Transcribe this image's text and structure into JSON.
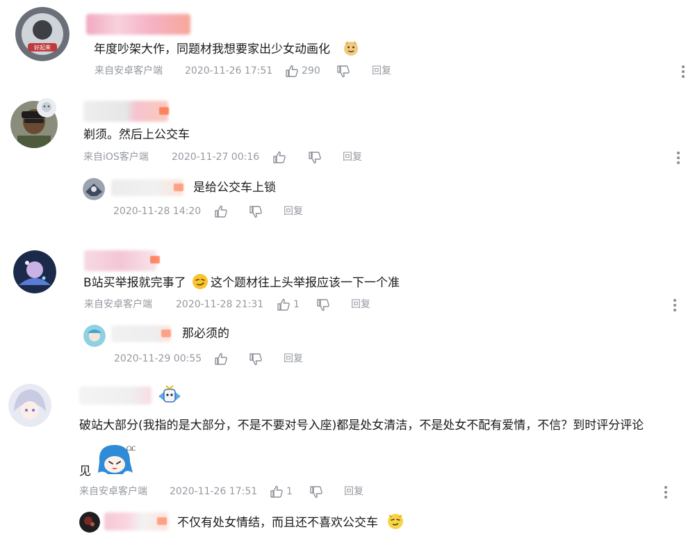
{
  "comments": [
    {
      "text": "年度吵架大作，同题材我想要家出少女动画化",
      "source": "来自安卓客户端",
      "time": "2020-11-26 17:51",
      "likes": "290",
      "reply": "回复"
    },
    {
      "text": "剃须。然后上公交车",
      "source": "来自iOS客户端",
      "time": "2020-11-27 00:16",
      "likes": "",
      "reply": "回复",
      "sub": {
        "text": "是给公交车上锁",
        "time": "2020-11-28 14:20",
        "reply": "回复"
      }
    },
    {
      "text": "B站买举报就完事了",
      "text2": "这个题材往上头举报应该一下一个准",
      "source": "来自安卓客户端",
      "time": "2020-11-28 21:31",
      "likes": "1",
      "reply": "回复",
      "sub": {
        "text": "那必须的",
        "time": "2020-11-29 00:55",
        "reply": "回复"
      }
    },
    {
      "text": "破站大部分(我指的是大部分，不是不要对号入座)都是处女清洁，不是处女不配有爱情，不信？到时评分评论",
      "text_cont": "见",
      "source": "来自安卓客户端",
      "time": "2020-11-26 17:51",
      "likes": "1",
      "reply": "回复",
      "sub": {
        "text": "不仅有处女情结，而且还不喜欢公交车"
      }
    }
  ],
  "colors": {
    "text": "#18191c",
    "meta": "#9499a0",
    "icon": "#8a8f96",
    "name_pink": "#f4a7bb",
    "level_orange": "#ff6a3d"
  },
  "icons": [
    "thumb-up-icon",
    "thumb-down-icon",
    "more-vertical-icon",
    "doge-emoji",
    "smirk-emoji",
    "bilibili-girl-emoji"
  ]
}
